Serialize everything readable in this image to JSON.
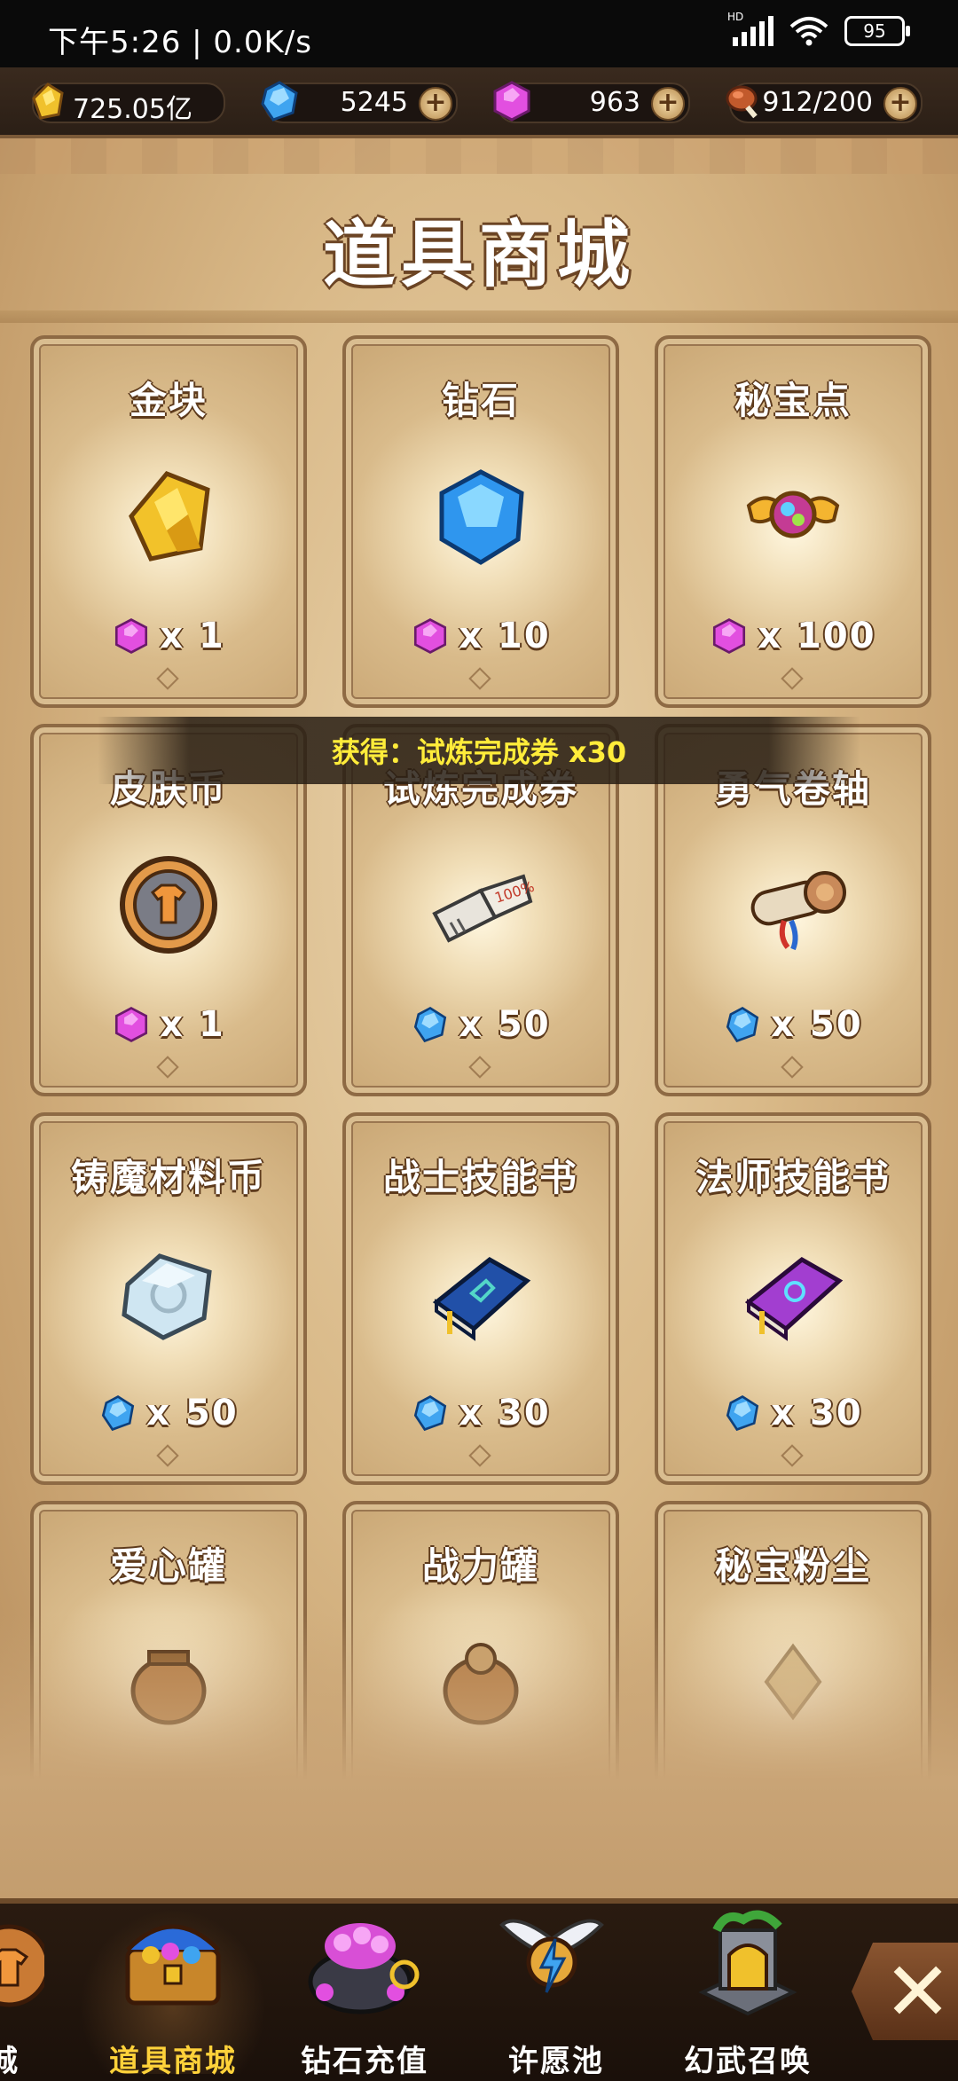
{
  "status_bar": {
    "time": "下午5:26 | 0.0K/s",
    "battery": "95"
  },
  "currencies": [
    {
      "name": "gold",
      "value": "725.05亿",
      "icon": "gold-nugget-icon"
    },
    {
      "name": "diamond",
      "value": "5245",
      "icon": "blue-diamond-icon"
    },
    {
      "name": "gem",
      "value": "963",
      "icon": "pink-gem-icon"
    },
    {
      "name": "stamina",
      "value": "912/200",
      "icon": "meat-icon"
    }
  ],
  "page_title": "道具商城",
  "toast": "获得：试炼完成券 x30",
  "items": [
    {
      "name": "金块",
      "price": "x 1",
      "currency": "pink-gem-icon",
      "icon": "gold-nugget-icon"
    },
    {
      "name": "钻石",
      "price": "x 10",
      "currency": "pink-gem-icon",
      "icon": "blue-diamond-icon"
    },
    {
      "name": "秘宝点",
      "price": "x 100",
      "currency": "pink-gem-icon",
      "icon": "winged-orb-icon"
    },
    {
      "name": "皮肤币",
      "price": "x 1",
      "currency": "pink-gem-icon",
      "icon": "skin-coin-icon"
    },
    {
      "name": "试炼完成券",
      "price": "x 50",
      "currency": "blue-diamond-icon",
      "icon": "ticket-icon"
    },
    {
      "name": "勇气卷轴",
      "price": "x 50",
      "currency": "blue-diamond-icon",
      "icon": "scroll-icon"
    },
    {
      "name": "铸魔材料币",
      "price": "x 50",
      "currency": "blue-diamond-icon",
      "icon": "crystal-coin-icon"
    },
    {
      "name": "战士技能书",
      "price": "x 30",
      "currency": "blue-diamond-icon",
      "icon": "blue-book-icon"
    },
    {
      "name": "法师技能书",
      "price": "x 30",
      "currency": "blue-diamond-icon",
      "icon": "purple-book-icon"
    },
    {
      "name": "爱心罐",
      "icon": "jar-icon"
    },
    {
      "name": "战力罐",
      "icon": "jar-icon"
    },
    {
      "name": "秘宝粉尘",
      "icon": "dust-icon"
    }
  ],
  "bottom_nav": [
    {
      "label": "商城",
      "icon": "shop-icon"
    },
    {
      "label": "道具商城",
      "icon": "treasure-chest-icon",
      "active": true
    },
    {
      "label": "钻石充值",
      "icon": "gem-pot-icon"
    },
    {
      "label": "许愿池",
      "icon": "winged-emblem-icon"
    },
    {
      "label": "幻武召唤",
      "icon": "shrine-icon"
    }
  ],
  "close_icon": "close-icon",
  "colors": {
    "gold_label": "#ffd23a",
    "toast_text": "#ffec3a"
  }
}
